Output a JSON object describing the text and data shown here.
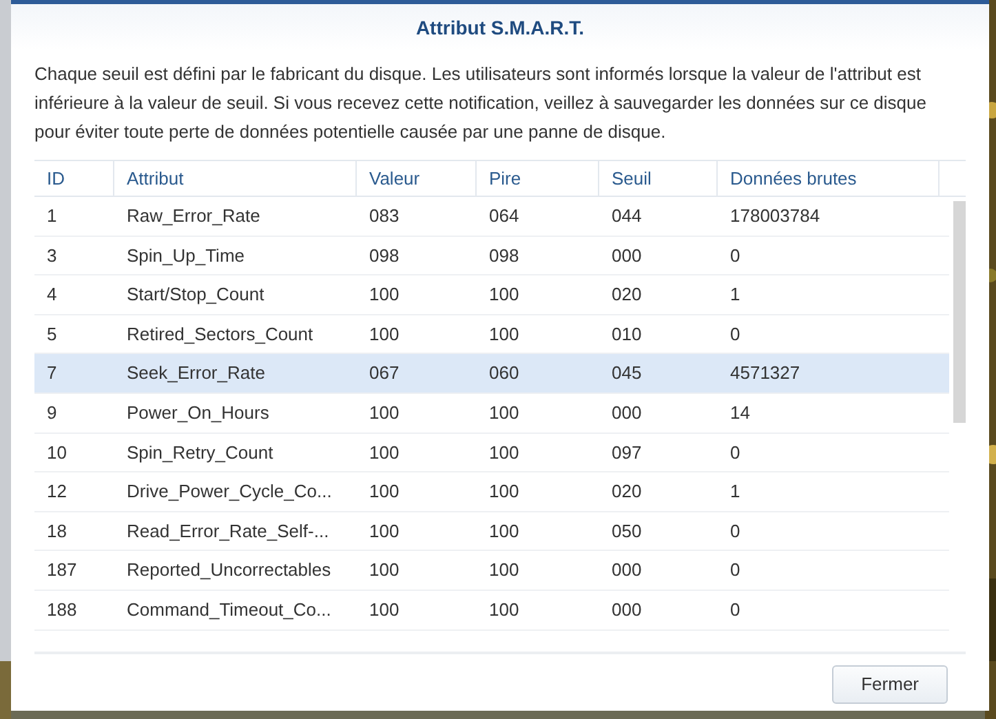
{
  "dialog": {
    "title": "Attribut S.M.A.R.T.",
    "description": "Chaque seuil est défini par le fabricant du disque. Les utilisateurs sont informés lorsque la valeur de l'attribut est inférieure à la valeur de seuil. Si vous recevez cette notification, veillez à sauvegarder les données sur ce disque pour éviter toute perte de données potentielle causée par une panne de disque."
  },
  "table": {
    "columns": [
      "ID",
      "Attribut",
      "Valeur",
      "Pire",
      "Seuil",
      "Données brutes"
    ],
    "rows": [
      {
        "cells": [
          "1",
          "Raw_Error_Rate",
          "083",
          "064",
          "044",
          "178003784"
        ],
        "selected": false
      },
      {
        "cells": [
          "3",
          "Spin_Up_Time",
          "098",
          "098",
          "000",
          "0"
        ],
        "selected": false
      },
      {
        "cells": [
          "4",
          "Start/Stop_Count",
          "100",
          "100",
          "020",
          "1"
        ],
        "selected": false
      },
      {
        "cells": [
          "5",
          "Retired_Sectors_Count",
          "100",
          "100",
          "010",
          "0"
        ],
        "selected": false
      },
      {
        "cells": [
          "7",
          "Seek_Error_Rate",
          "067",
          "060",
          "045",
          "4571327"
        ],
        "selected": true
      },
      {
        "cells": [
          "9",
          "Power_On_Hours",
          "100",
          "100",
          "000",
          "14"
        ],
        "selected": false
      },
      {
        "cells": [
          "10",
          "Spin_Retry_Count",
          "100",
          "100",
          "097",
          "0"
        ],
        "selected": false
      },
      {
        "cells": [
          "12",
          "Drive_Power_Cycle_Co...",
          "100",
          "100",
          "020",
          "1"
        ],
        "selected": false
      },
      {
        "cells": [
          "18",
          "Read_Error_Rate_Self-...",
          "100",
          "100",
          "050",
          "0"
        ],
        "selected": false
      },
      {
        "cells": [
          "187",
          "Reported_Uncorrectables",
          "100",
          "100",
          "000",
          "0"
        ],
        "selected": false
      },
      {
        "cells": [
          "188",
          "Command_Timeout_Co...",
          "100",
          "100",
          "000",
          "0"
        ],
        "selected": false
      }
    ]
  },
  "buttons": [
    "Fermer"
  ]
}
